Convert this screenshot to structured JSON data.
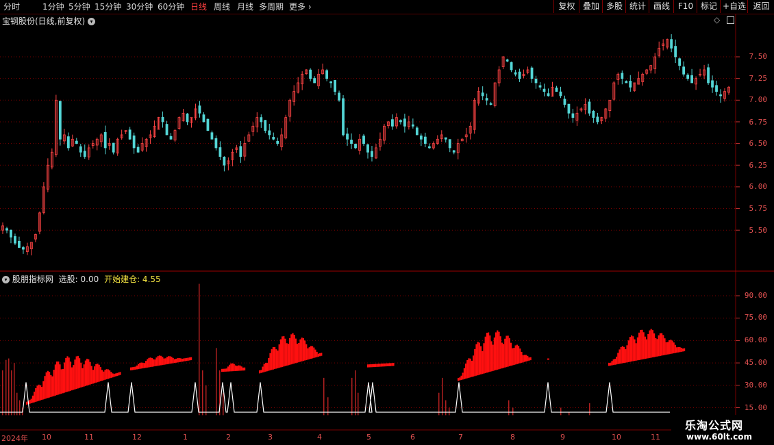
{
  "toolbar": {
    "periods": [
      "分时",
      "1分钟",
      "5分钟",
      "15分钟",
      "30分钟",
      "60分钟",
      "日线",
      "周线",
      "月线",
      "多周期",
      "更多"
    ],
    "active_period": "日线",
    "right_buttons": [
      "复权",
      "叠加",
      "多股",
      "统计",
      "画线",
      "F10",
      "标记",
      "+自选",
      "返回"
    ]
  },
  "main_panel": {
    "title": "宝钢股份(日线,前复权)",
    "y_ticks": [
      "7.50",
      "7.25",
      "7.00",
      "6.75",
      "6.50",
      "6.25",
      "6.00",
      "5.75",
      "5.50"
    ]
  },
  "indicator_panel": {
    "name": "股朋指标网",
    "select_label": "选股: 0.00",
    "start_label": "开始建仓: 4.55",
    "y_ticks": [
      "90.00",
      "75.00",
      "60.00",
      "45.00",
      "30.00",
      "15.00"
    ]
  },
  "x_axis": {
    "labels": [
      "2024年",
      "10",
      "11",
      "12",
      "1",
      "2",
      "3",
      "4",
      "5",
      "6",
      "7",
      "8",
      "9",
      "10",
      "11"
    ]
  },
  "watermark": {
    "title": "乐淘公式网",
    "url": "www.60lt.com"
  },
  "colors": {
    "up": "#ff4444",
    "down": "#54d6d6",
    "bar": "#ff1010",
    "grid": "#7a0000",
    "axis_text": "#e05050"
  },
  "chart_data": {
    "type": "candlestick",
    "price_range": [
      5.25,
      7.75
    ],
    "indicator_range": [
      10,
      100
    ],
    "closes": [
      5.55,
      5.5,
      5.42,
      5.35,
      5.3,
      5.28,
      5.31,
      5.36,
      5.45,
      5.7,
      6.0,
      6.25,
      6.4,
      7.0,
      6.55,
      6.6,
      6.45,
      6.55,
      6.5,
      6.4,
      6.35,
      6.45,
      6.5,
      6.55,
      6.6,
      6.45,
      6.5,
      6.4,
      6.55,
      6.6,
      6.65,
      6.55,
      6.45,
      6.4,
      6.5,
      6.55,
      6.6,
      6.7,
      6.8,
      6.75,
      6.6,
      6.55,
      6.65,
      6.8,
      6.85,
      6.75,
      6.8,
      6.9,
      6.85,
      6.75,
      6.65,
      6.55,
      6.45,
      6.35,
      6.25,
      6.3,
      6.4,
      6.45,
      6.35,
      6.5,
      6.6,
      6.7,
      6.8,
      6.75,
      6.65,
      6.6,
      6.55,
      6.5,
      6.6,
      6.8,
      7.0,
      7.1,
      7.2,
      7.3,
      7.35,
      7.25,
      7.2,
      7.3,
      7.35,
      7.25,
      7.2,
      7.1,
      7.0,
      6.6,
      6.55,
      6.5,
      6.45,
      6.55,
      6.5,
      6.4,
      6.35,
      6.45,
      6.55,
      6.7,
      6.75,
      6.7,
      6.8,
      6.75,
      6.7,
      6.75,
      6.7,
      6.6,
      6.55,
      6.5,
      6.45,
      6.5,
      6.55,
      6.6,
      6.55,
      6.45,
      6.4,
      6.5,
      6.55,
      6.6,
      6.7,
      7.0,
      7.1,
      7.05,
      7.0,
      6.95,
      7.2,
      7.35,
      7.5,
      7.45,
      7.35,
      7.3,
      7.25,
      7.3,
      7.35,
      7.25,
      7.2,
      7.15,
      7.1,
      7.05,
      7.15,
      7.1,
      7.05,
      6.95,
      6.85,
      6.8,
      6.85,
      6.9,
      6.95,
      6.85,
      6.8,
      6.75,
      6.8,
      6.9,
      7.0,
      7.2,
      7.3,
      7.25,
      7.2,
      7.15,
      7.2,
      7.25,
      7.3,
      7.35,
      7.4,
      7.5,
      7.6,
      7.65,
      7.7,
      7.6,
      7.5,
      7.4,
      7.3,
      7.25,
      7.2,
      7.25,
      7.3,
      7.35,
      7.2,
      7.15,
      7.1,
      7.05,
      7.1,
      7.15
    ]
  }
}
